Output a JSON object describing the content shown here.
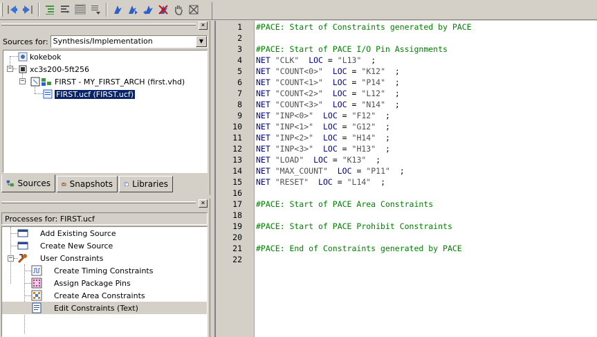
{
  "toolbar": {
    "icons": [
      "back-icon",
      "forward-icon",
      "indent-icon",
      "outdent-icon",
      "comment-icon",
      "uncomment-icon",
      "bookmark-toggle-icon",
      "bookmark-next-icon",
      "bookmark-prev-icon",
      "bookmark-clear-icon",
      "pan-hand-icon",
      "stop-icon"
    ]
  },
  "sources": {
    "label": "Sources for:",
    "selected": "Synthesis/Implementation",
    "tree": [
      {
        "label": "kokebok",
        "icon": "document-icon"
      },
      {
        "label": "xc3s200-5ft256",
        "icon": "chip-icon"
      },
      {
        "label": "FIRST - MY_FIRST_ARCH (first.vhd)",
        "icon": "vhdl-module-icon"
      },
      {
        "label": "FIRST.ucf (FIRST.ucf)",
        "icon": "ucf-file-icon",
        "selected": true
      }
    ],
    "tabs": [
      {
        "label": "Sources",
        "icon": "sources-tab-icon",
        "active": true
      },
      {
        "label": "Snapshots",
        "icon": "snapshots-tab-icon"
      },
      {
        "label": "Libraries",
        "icon": "libraries-tab-icon"
      }
    ]
  },
  "processes": {
    "header": "Processes for: FIRST.ucf",
    "items": [
      {
        "label": "Add Existing Source",
        "icon": "window-icon",
        "level": 1
      },
      {
        "label": "Create New Source",
        "icon": "window-icon",
        "level": 1
      },
      {
        "label": "User Constraints",
        "icon": "tools-icon",
        "level": 1
      },
      {
        "label": "Create Timing Constraints",
        "icon": "timing-icon",
        "level": 2
      },
      {
        "label": "Assign Package Pins",
        "icon": "pins-icon",
        "level": 2
      },
      {
        "label": "Create Area Constraints",
        "icon": "area-icon",
        "level": 2
      },
      {
        "label": "Edit Constraints (Text)",
        "icon": "text-edit-icon",
        "level": 2,
        "highlighted": true
      }
    ]
  },
  "editor": {
    "lines": [
      {
        "n": "1",
        "type": "comment",
        "text": "#PACE: Start of Constraints generated by PACE"
      },
      {
        "n": "2",
        "type": "empty",
        "text": ""
      },
      {
        "n": "3",
        "type": "comment",
        "text": "#PACE: Start of PACE I/O Pin Assignments"
      },
      {
        "n": "4",
        "type": "net",
        "name": "\"CLK\"",
        "gap1": "  ",
        "loc": "\"L13\"",
        "tail": "  ;"
      },
      {
        "n": "5",
        "type": "net",
        "name": "\"COUNT<0>\"",
        "gap1": "  ",
        "loc": "\"K12\"",
        "tail": "  ;"
      },
      {
        "n": "6",
        "type": "net",
        "name": "\"COUNT<1>\"",
        "gap1": "  ",
        "loc": "\"P14\"",
        "tail": "  ;"
      },
      {
        "n": "7",
        "type": "net",
        "name": "\"COUNT<2>\"",
        "gap1": "  ",
        "loc": "\"L12\"",
        "tail": "  ;"
      },
      {
        "n": "8",
        "type": "net",
        "name": "\"COUNT<3>\"",
        "gap1": "  ",
        "loc": "\"N14\"",
        "tail": "  ;"
      },
      {
        "n": "9",
        "type": "net",
        "name": "\"INP<0>\"",
        "gap1": "  ",
        "loc": "\"F12\"",
        "tail": "  ;"
      },
      {
        "n": "10",
        "type": "net",
        "name": "\"INP<1>\"",
        "gap1": "  ",
        "loc": "\"G12\"",
        "tail": "  ;"
      },
      {
        "n": "11",
        "type": "net",
        "name": "\"INP<2>\"",
        "gap1": "  ",
        "loc": "\"H14\"",
        "tail": "  ;"
      },
      {
        "n": "12",
        "type": "net",
        "name": "\"INP<3>\"",
        "gap1": "  ",
        "loc": "\"H13\"",
        "tail": "  ;"
      },
      {
        "n": "13",
        "type": "net",
        "name": "\"LOAD\"",
        "gap1": "  ",
        "loc": "\"K13\"",
        "tail": "  ;"
      },
      {
        "n": "14",
        "type": "net",
        "name": "\"MAX_COUNT\"",
        "gap1": "  ",
        "loc": "\"P11\"",
        "tail": "  ;"
      },
      {
        "n": "15",
        "type": "net",
        "name": "\"RESET\"",
        "gap1": "  ",
        "loc": "\"L14\"",
        "tail": "  ;"
      },
      {
        "n": "16",
        "type": "empty",
        "text": ""
      },
      {
        "n": "17",
        "type": "comment",
        "text": "#PACE: Start of PACE Area Constraints"
      },
      {
        "n": "18",
        "type": "empty",
        "text": ""
      },
      {
        "n": "19",
        "type": "comment",
        "text": "#PACE: Start of PACE Prohibit Constraints"
      },
      {
        "n": "20",
        "type": "empty",
        "text": ""
      },
      {
        "n": "21",
        "type": "comment",
        "text": "#PACE: End of Constraints generated by PACE"
      },
      {
        "n": "22",
        "type": "empty",
        "text": ""
      }
    ],
    "keyword_net": "NET",
    "keyword_loc": "LOC",
    "equals": "=",
    "colors": {
      "comment": "#008000",
      "keyword": "#00008b",
      "string": "#505050"
    }
  }
}
